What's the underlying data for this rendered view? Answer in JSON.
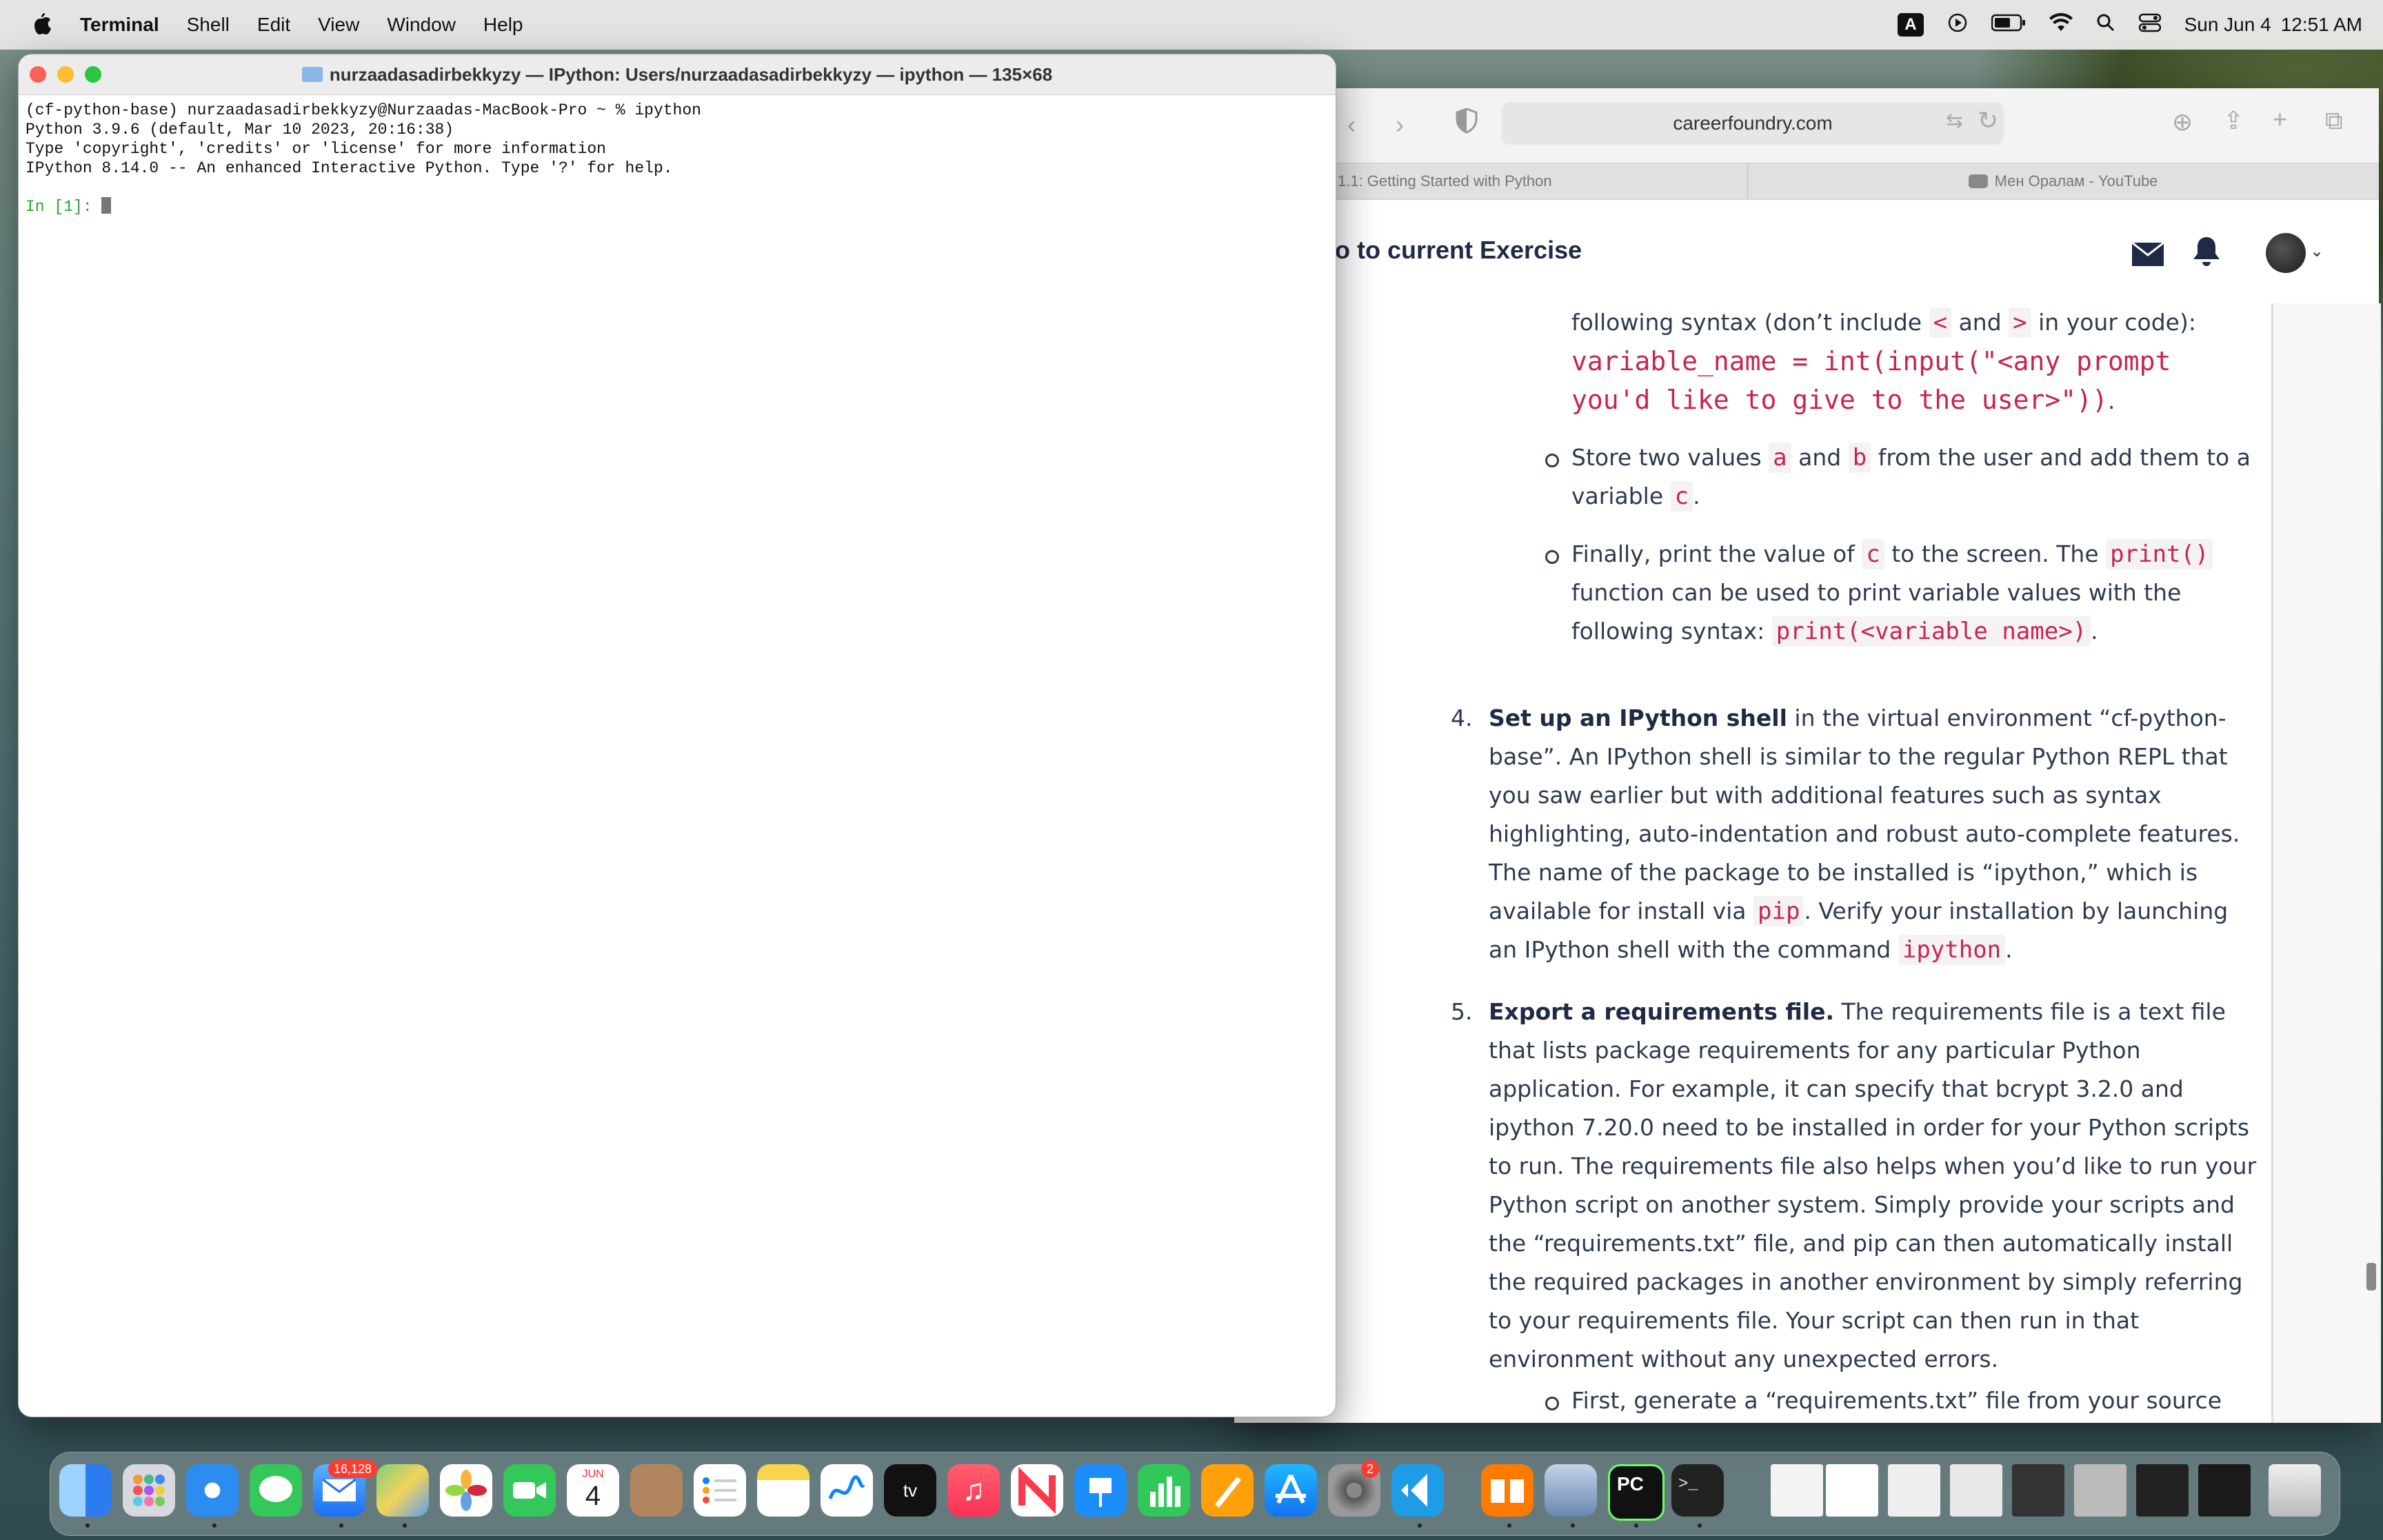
{
  "menubar": {
    "app_name": "Terminal",
    "items": [
      "Shell",
      "Edit",
      "View",
      "Window",
      "Help"
    ],
    "date": "Sun Jun 4",
    "time": "12:51 AM",
    "input_source": "A"
  },
  "terminal": {
    "title": "nurzaadasadirbekkyzy — IPython: Users/nurzaadasadirbekkyzy — ipython — 135×68",
    "lines": [
      "(cf-python-base) nurzaadasadirbekkyzy@Nurzaadas-MacBook-Pro ~ % ipython",
      "Python 3.9.6 (default, Mar 10 2023, 20:16:38)",
      "Type 'copyright', 'credits' or 'license' for more information",
      "IPython 8.14.0 -- An enhanced Interactive Python. Type '?' for help."
    ],
    "prompt": "In [1]:"
  },
  "browser": {
    "url": "careerfoundry.com",
    "tabs": [
      "1.1: Getting Started with Python",
      "Мен Оралам - YouTube"
    ],
    "header_link": "o to current Exercise"
  },
  "content": {
    "item3_intro": "following syntax (don’t include",
    "item3_lt": "<",
    "item3_and": "and",
    "item3_gt": ">",
    "item3_tail": "in your code):",
    "item3_code1": "variable_name = int(input(\"<any prompt",
    "item3_code2": "you'd like to give to the user>\"))",
    "item3_period": ".",
    "b1_pre": "Store two values",
    "b1_a": "a",
    "b1_and": "and",
    "b1_b": "b",
    "b1_post": "from the user and add them to a",
    "b1_l2": "variable",
    "b1_c": "c",
    "b1_end": ".",
    "b2_pre": "Finally, print the value of",
    "b2_c": "c",
    "b2_mid": "to the screen. The",
    "b2_code": "print()",
    "b2_l2": "function can be used to print variable values with the",
    "b2_l3": "following syntax:",
    "b2_code2": "print(<variable name>)",
    "b2_end": ".",
    "n4": "4.",
    "n4_title": "Set up an IPython shell",
    "n4_l1": "in the virtual environment “cf-python-",
    "n4_l2": "base”. An IPython shell is similar to the regular Python REPL that",
    "n4_l3": "you saw earlier but with additional features such as syntax",
    "n4_l4": "highlighting, auto-indentation and robust auto-complete features.",
    "n4_l5": "The name of the package to be installed is “ipython,” which is",
    "n4_l6a": "available for install via",
    "n4_pip": "pip",
    "n4_l6b": ". Verify your installation by launching",
    "n4_l7a": "an IPython shell with the command",
    "n4_ipy": "ipython",
    "n4_l7b": ".",
    "n5": "5.",
    "n5_title": "Export a requirements file.",
    "n5_l1": "The requirements file is a text file",
    "n5_l2": "that lists package requirements for any particular Python",
    "n5_l3": "application. For example, it can specify that bcrypt 3.2.0 and",
    "n5_l4": "ipython 7.20.0 need to be installed in order for your Python scripts",
    "n5_l5": "to run. The requirements file also helps when you’d like to run your",
    "n5_l6": "Python script on another system. Simply provide your scripts and",
    "n5_l7": "the “requirements.txt” file, and pip can then automatically install",
    "n5_l8": "the required packages in another environment by simply referring",
    "n5_l9": "to your requirements file. Your script can then run in that",
    "n5_l10": "environment without any unexpected errors.",
    "b3": "First, generate a “requirements.txt” file from your source"
  },
  "dock": {
    "mail_badge": "16,128",
    "calendar_month": "JUN",
    "calendar_day": "4",
    "settings_badge": "2",
    "tv_label": "tv",
    "pycharm_label": "PC"
  }
}
